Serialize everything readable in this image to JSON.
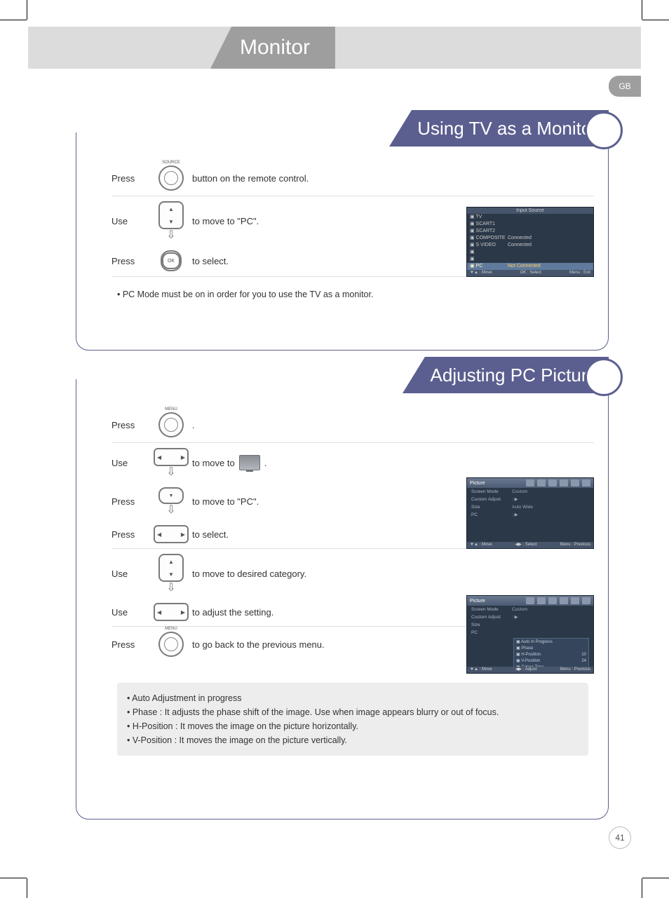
{
  "page": {
    "header_title": "Monitor",
    "lang_badge": "GB",
    "number": "41"
  },
  "section1": {
    "title": "Using TV as a Monitor",
    "rows": {
      "r1": {
        "verb": "Press",
        "btn_label": "SOURCE",
        "desc": "button on the remote control."
      },
      "r2": {
        "verb": "Use",
        "desc": "to move to  \"PC\"."
      },
      "r3": {
        "verb": "Press",
        "btn_label": "OK",
        "desc": "to select."
      }
    },
    "note": "• PC Mode must be on in order for you to use the TV as a monitor.",
    "osd": {
      "title": "Input Source",
      "items": [
        {
          "k": "TV",
          "v": ""
        },
        {
          "k": "SCART1",
          "v": ""
        },
        {
          "k": "SCART2",
          "v": ""
        },
        {
          "k": "COMPOSITE",
          "v": "Connected"
        },
        {
          "k": "S VIDEO",
          "v": "Connected"
        },
        {
          "k": "",
          "v": ""
        },
        {
          "k": "",
          "v": ""
        },
        {
          "k": "PC",
          "v": "Not Connected",
          "sel": true
        }
      ],
      "footer_left": "▼▲ : Move",
      "footer_mid": "OK : Select",
      "footer_right": "Menu : Exit"
    }
  },
  "section2": {
    "title": "Adjusting PC Picture",
    "rows": {
      "r1": {
        "verb": "Press",
        "btn_label": "MENU",
        "desc": "."
      },
      "r2": {
        "verb": "Use",
        "desc_pre": "to move to",
        "desc_post": "."
      },
      "r3": {
        "verb": "Press",
        "desc": "to move to \"PC\"."
      },
      "r4": {
        "verb": "Press",
        "desc": "to select."
      },
      "r5": {
        "verb": "Use",
        "desc": "to move to desired category."
      },
      "r6": {
        "verb": "Use",
        "desc": "to adjust the setting."
      },
      "r7": {
        "verb": "Press",
        "btn_label": "MENU",
        "desc": "to go back to the previous menu."
      }
    },
    "osd1": {
      "tab": "Picture",
      "menu": [
        {
          "k": "Screen Mode",
          "v": "Custom"
        },
        {
          "k": "Custom Adjust",
          "v": ": ▶"
        },
        {
          "k": "Size",
          "v": "Auto Wide"
        },
        {
          "k": "PC",
          "v": ": ▶"
        }
      ],
      "footer_left": "▼▲ : Move",
      "footer_mid": "◀▶ : Select",
      "footer_right": "Menu : Previous"
    },
    "osd2": {
      "tab": "Picture",
      "menu": [
        {
          "k": "Screen Mode",
          "v": "Custom"
        },
        {
          "k": "Custom Adjust",
          "v": ": ▶"
        },
        {
          "k": "Size",
          "v": ""
        },
        {
          "k": "PC",
          "v": ""
        }
      ],
      "sub": [
        {
          "k": "Auto In Progress",
          "v": ""
        },
        {
          "k": "Phase",
          "v": ""
        },
        {
          "k": "H-Position",
          "v": "10"
        },
        {
          "k": "V-Position",
          "v": "24"
        },
        {
          "k": "Colour Tone",
          "v": ""
        }
      ],
      "footer_left": "▼▲ : Move",
      "footer_mid": "◀▶ : Adjust",
      "footer_right": "Menu : Previous"
    },
    "notes": {
      "n1": "• Auto Adjustment in progress",
      "n2": "• Phase : It adjusts the phase shift of the image.  Use when image appears blurry or out of focus.",
      "n3": "• H-Position : It moves the image on the picture horizontally.",
      "n4": "• V-Position : It moves the image on the picture vertically."
    }
  }
}
